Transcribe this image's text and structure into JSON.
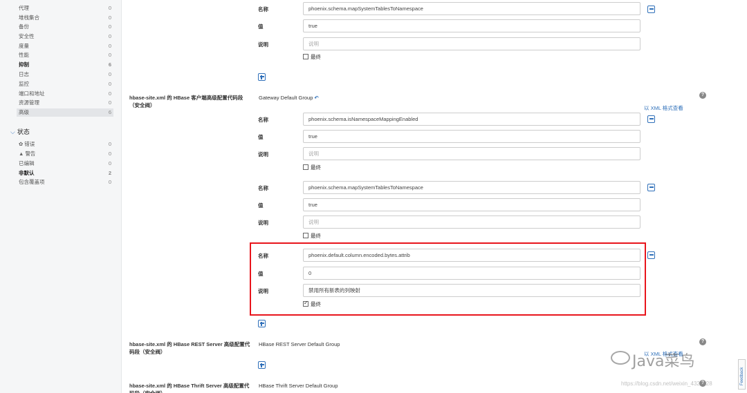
{
  "sidebar": {
    "categories": [
      {
        "label": "代理",
        "count": "0"
      },
      {
        "label": "堆栈集合",
        "count": "0"
      },
      {
        "label": "备份",
        "count": "0"
      },
      {
        "label": "安全性",
        "count": "0"
      },
      {
        "label": "度量",
        "count": "0"
      },
      {
        "label": "性能",
        "count": "0"
      },
      {
        "label": "抑制",
        "count": "6"
      },
      {
        "label": "日志",
        "count": "0"
      },
      {
        "label": "监控",
        "count": "0"
      },
      {
        "label": "端口和地址",
        "count": "0"
      },
      {
        "label": "资源管理",
        "count": "0"
      },
      {
        "label": "高级",
        "count": "6"
      }
    ],
    "status_heading": "状态",
    "status": [
      {
        "label": "错误",
        "count": "0"
      },
      {
        "label": "警告",
        "count": "0"
      },
      {
        "label": "已编辑",
        "count": "0"
      },
      {
        "label": "非默认",
        "count": "2"
      },
      {
        "label": "包含覆盖项",
        "count": "0"
      }
    ]
  },
  "labels": {
    "name": "名称",
    "value": "值",
    "description": "说明",
    "final": "最终",
    "description_placeholder": "说明",
    "xml_view": "以 XML 格式查看"
  },
  "sections": {
    "client": {
      "title": "hbase-site.xml 的 HBase 客户端高级配置代码段（安全阀）",
      "group": "Gateway Default Group"
    },
    "rest": {
      "title": "hbase-site.xml 的 HBase REST Server 高级配置代码段（安全阀）",
      "group": "HBase REST Server Default Group"
    },
    "thrift": {
      "title": "hbase-site.xml 的 HBase Thrift Server 高级配置代码段（安全阀）",
      "group": "HBase Thrift Server Default Group"
    }
  },
  "properties": {
    "top": {
      "name": "phoenix.schema.mapSystemTablesToNamespace",
      "value": "true",
      "description": "",
      "final": false
    },
    "p1": {
      "name": "phoenix.schema.isNamespaceMappingEnabled",
      "value": "true",
      "description": "",
      "final": false
    },
    "p2": {
      "name": "phoenix.schema.mapSystemTablesToNamespace",
      "value": "true",
      "description": "",
      "final": false
    },
    "p3": {
      "name": "phoenix.default.column.encoded.bytes.attrib",
      "value": "0",
      "description": "禁用所有新表的列映射",
      "final": true
    }
  },
  "watermark": {
    "brand": "Java菜鸟",
    "url": "https://blog.csdn.net/weixin_4321628"
  },
  "feedback_label": "Feedback",
  "colors": {
    "accent": "#2e6fb9",
    "highlight_border": "#e8141b"
  }
}
